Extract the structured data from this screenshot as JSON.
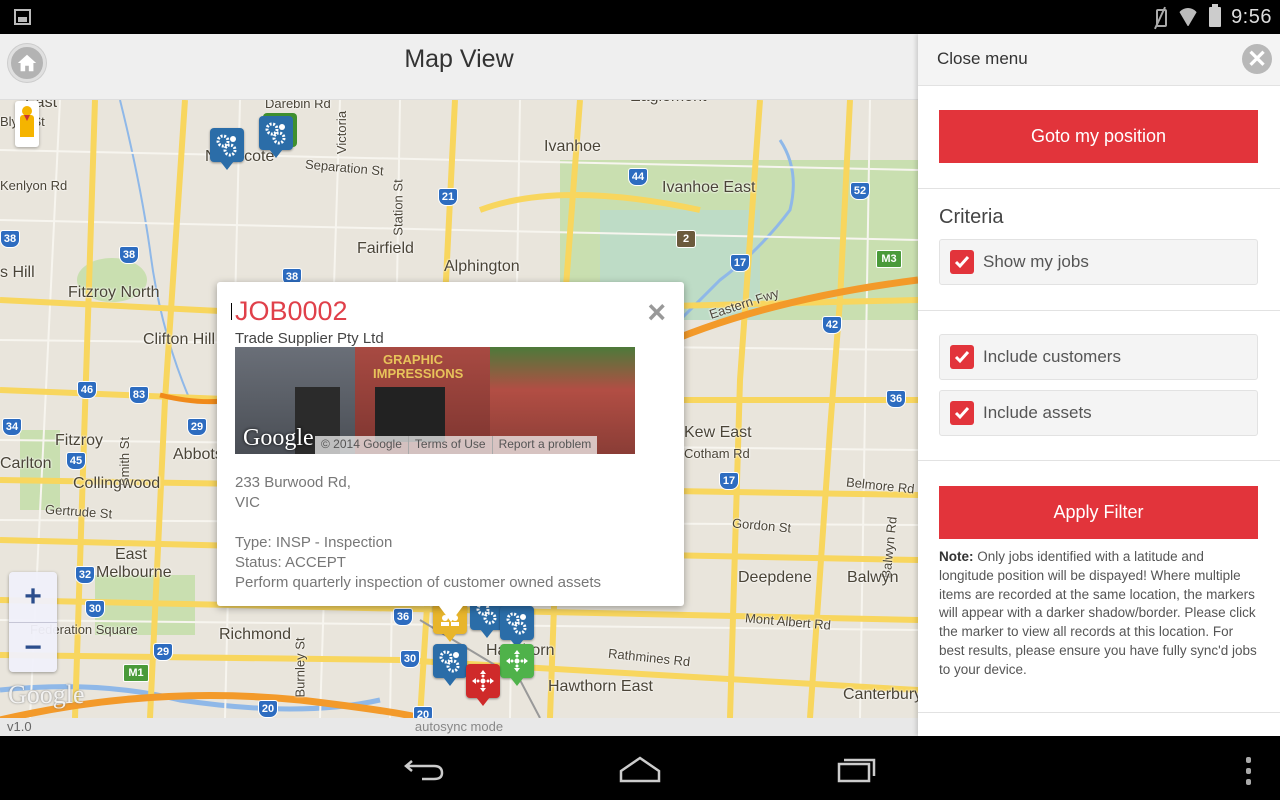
{
  "status_bar": {
    "time": "9:56",
    "icons": [
      "gallery-notification-icon",
      "mute-icon",
      "wifi-icon",
      "battery-icon"
    ]
  },
  "header": {
    "title": "Map View",
    "home_icon": "home-icon"
  },
  "map": {
    "labels": [
      {
        "text": "East",
        "name": "area-east"
      },
      {
        "text": "Blyth St",
        "name": "street-blyth"
      },
      {
        "text": "Darebin Rd",
        "name": "street-darebin"
      },
      {
        "text": "Northcote",
        "name": "suburb-northcote"
      },
      {
        "text": "Separation St",
        "name": "street-separation"
      },
      {
        "text": "Victoria",
        "name": "street-victoria"
      },
      {
        "text": "Station St",
        "name": "street-station"
      },
      {
        "text": "Eaglemont",
        "name": "suburb-eaglemont"
      },
      {
        "text": "Ivanhoe",
        "name": "suburb-ivanhoe"
      },
      {
        "text": "Ivanhoe East",
        "name": "suburb-ivanhoe-east"
      },
      {
        "text": "Fairfield",
        "name": "suburb-fairfield"
      },
      {
        "text": "Alphington",
        "name": "suburb-alphington"
      },
      {
        "text": "Kenlyon Rd",
        "name": "street-kenlyon"
      },
      {
        "text": "s Hill",
        "name": "suburb-hill"
      },
      {
        "text": "Fitzroy North",
        "name": "suburb-fitzroy-north"
      },
      {
        "text": "Clifton Hill",
        "name": "suburb-clifton-hill"
      },
      {
        "text": "Eastern Fwy",
        "name": "road-eastern-fwy"
      },
      {
        "text": "Fitzroy",
        "name": "suburb-fitzroy"
      },
      {
        "text": "Smith St",
        "name": "street-smith"
      },
      {
        "text": "Abbotsford",
        "name": "suburb-abbotsford"
      },
      {
        "text": "Carlton",
        "name": "suburb-carlton"
      },
      {
        "text": "Collingwood",
        "name": "suburb-collingwood"
      },
      {
        "text": "Gertrude St",
        "name": "street-gertrude"
      },
      {
        "text": "East Melbourne",
        "name": "suburb-east-melbourne"
      },
      {
        "text": "Federation Square",
        "name": "place-federation-square"
      },
      {
        "text": "Richmond",
        "name": "suburb-richmond"
      },
      {
        "text": "Burnley St",
        "name": "street-burnley"
      },
      {
        "text": "Hawthorn",
        "name": "suburb-hawthorn"
      },
      {
        "text": "Hawthorn East",
        "name": "suburb-hawthorn-east"
      },
      {
        "text": "Rathmines Rd",
        "name": "street-rathmines"
      },
      {
        "text": "Belmore Rd",
        "name": "street-belmore"
      },
      {
        "text": "Balwyn Rd",
        "name": "street-balwyn-rd"
      },
      {
        "text": "Gordon St",
        "name": "street-gordon"
      },
      {
        "text": "Deepdene",
        "name": "suburb-deepdene"
      },
      {
        "text": "Balwyn",
        "name": "suburb-balwyn"
      },
      {
        "text": "Mont Albert Rd",
        "name": "street-mont-albert"
      },
      {
        "text": "Canterbury",
        "name": "suburb-canterbury"
      },
      {
        "text": "Kew East",
        "name": "suburb-kew-east"
      },
      {
        "text": "Cotham Rd",
        "name": "street-cotham"
      }
    ],
    "route_shields": [
      "38",
      "38",
      "38",
      "21",
      "44",
      "52",
      "2",
      "17",
      "M3",
      "42",
      "46",
      "83",
      "34",
      "29",
      "45",
      "36",
      "17",
      "32",
      "30",
      "30",
      "29",
      "M1",
      "20",
      "20",
      "36",
      "20"
    ],
    "zoom_in_label": "+",
    "zoom_out_label": "−",
    "attribution": "Google",
    "markers": [
      {
        "type": "job",
        "color": "blue"
      },
      {
        "type": "job",
        "color": "blue",
        "stacked": true
      },
      {
        "type": "customer",
        "color": "yellow"
      },
      {
        "type": "job",
        "color": "blue"
      },
      {
        "type": "job",
        "color": "blue"
      },
      {
        "type": "job",
        "color": "blue"
      },
      {
        "type": "asset",
        "color": "green"
      },
      {
        "type": "asset",
        "color": "red"
      }
    ]
  },
  "info_window": {
    "job_id": "JOB0002",
    "customer": "Trade Supplier Pty Ltd",
    "photo": {
      "sign_text": "GRAPHIC IMPRESSIONS",
      "logo": "Google",
      "copyright": "© 2014 Google",
      "terms": "Terms of Use",
      "report": "Report a problem"
    },
    "address_line1": "233 Burwood Rd,",
    "address_line2": "VIC",
    "type": "Type: INSP - Inspection",
    "status": "Status: ACCEPT",
    "description": "Perform quarterly inspection of customer owned assets",
    "close_label": "×"
  },
  "sidebar": {
    "close_menu_label": "Close menu",
    "goto_position_label": "Goto my position",
    "criteria_title": "Criteria",
    "checkboxes": [
      {
        "label": "Show my jobs",
        "checked": true
      },
      {
        "label": "Include customers",
        "checked": true
      },
      {
        "label": "Include assets",
        "checked": true
      }
    ],
    "apply_filter_label": "Apply Filter",
    "note_label": "Note:",
    "note_text": " Only jobs identified with a latitude and longitude position will be dispayed! Where multiple items are recorded at the same location, the markers will appear with a darker shadow/border. Please click the marker to view all records at this location. For best results, please ensure you have fully sync'd jobs to your device."
  },
  "footer": {
    "version": "v1.0",
    "sync_mode": "autosync mode"
  },
  "colors": {
    "accent_red": "#e2343b",
    "job_id_red": "#e0404a",
    "marker_blue": "#2b6da8",
    "marker_green": "#4fb24a",
    "marker_red": "#cf2a2a",
    "marker_yellow": "#e8b52b"
  }
}
